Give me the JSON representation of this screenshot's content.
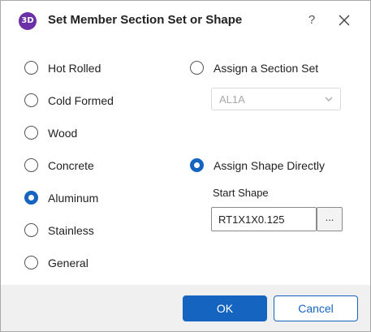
{
  "window": {
    "app_icon_text": "3D",
    "title": "Set Member Section Set or Shape",
    "help_label": "?",
    "close_icon": "close-icon"
  },
  "material_options": [
    {
      "label": "Hot Rolled",
      "checked": false
    },
    {
      "label": "Cold Formed",
      "checked": false
    },
    {
      "label": "Wood",
      "checked": false
    },
    {
      "label": "Concrete",
      "checked": false
    },
    {
      "label": "Aluminum",
      "checked": true
    },
    {
      "label": "Stainless",
      "checked": false
    },
    {
      "label": "General",
      "checked": false
    }
  ],
  "assign_section_set": {
    "label": "Assign a Section Set",
    "checked": false,
    "dropdown_value": "AL1A",
    "dropdown_icon": "chevron-down-icon"
  },
  "assign_shape": {
    "label": "Assign Shape Directly",
    "checked": true,
    "start_shape_label": "Start Shape",
    "start_shape_value": "RT1X1X0.125",
    "browse_label": "..."
  },
  "buttons": {
    "ok": "OK",
    "cancel": "Cancel"
  },
  "colors": {
    "accent": "#1565c0",
    "app_icon": "#6b2fa8",
    "footer": "#f0f0f0"
  }
}
